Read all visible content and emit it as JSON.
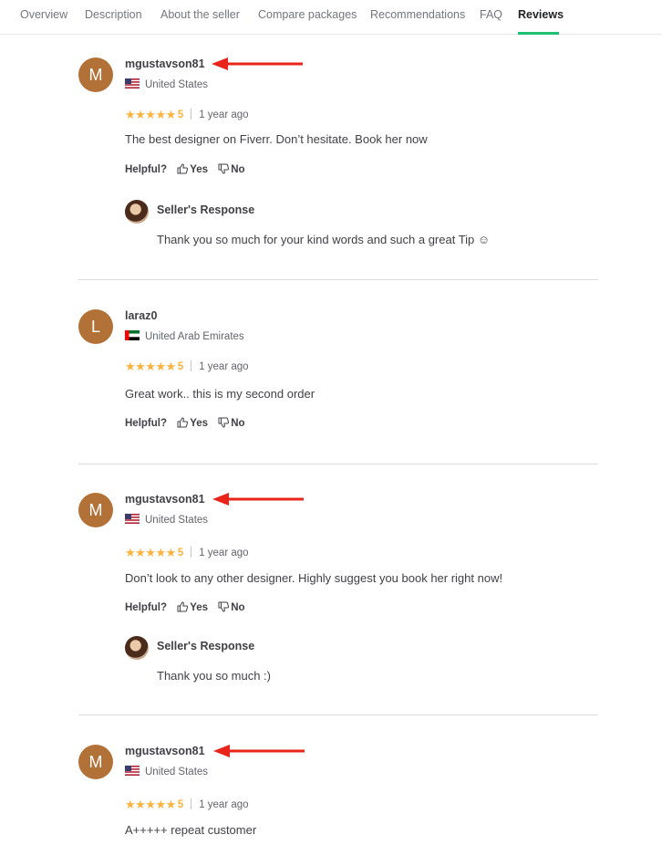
{
  "tabs": [
    {
      "label": "Overview"
    },
    {
      "label": "Description"
    },
    {
      "label": "About the seller"
    },
    {
      "label": "Compare packages"
    },
    {
      "label": "Recommendations"
    },
    {
      "label": "FAQ"
    },
    {
      "label": "Reviews",
      "active": true
    }
  ],
  "helpful_label": "Helpful?",
  "yes_label": "Yes",
  "no_label": "No",
  "seller_response_title": "Seller's Response",
  "colors": {
    "accent": "#1dbf73",
    "star": "#ffb33e",
    "avatar": "#b27137",
    "arrow": "#e8241b"
  },
  "reviews": [
    {
      "initial": "M",
      "username": "mgustavson81",
      "country": "United States",
      "stars": "★★★★★",
      "score": "5",
      "time": "1 year ago",
      "text": "The best designer on Fiverr. Don’t hesitate. Book her now",
      "response": "Thank you so much for your kind words and such a great Tip ☺"
    },
    {
      "initial": "L",
      "username": "laraz0",
      "country": "United Arab Emirates",
      "stars": "★★★★★",
      "score": "5",
      "time": "1 year ago",
      "text": "Great work.. this is my second order"
    },
    {
      "initial": "M",
      "username": "mgustavson81",
      "country": "United States",
      "stars": "★★★★★",
      "score": "5",
      "time": "1 year ago",
      "text": "Don’t look to any other designer. Highly suggest you book her right now!",
      "response": "Thank you so much :)"
    },
    {
      "initial": "M",
      "username": "mgustavson81",
      "country": "United States",
      "stars": "★★★★★",
      "score": "5",
      "time": "1 year ago",
      "text": "A+++++ repeat customer"
    }
  ]
}
